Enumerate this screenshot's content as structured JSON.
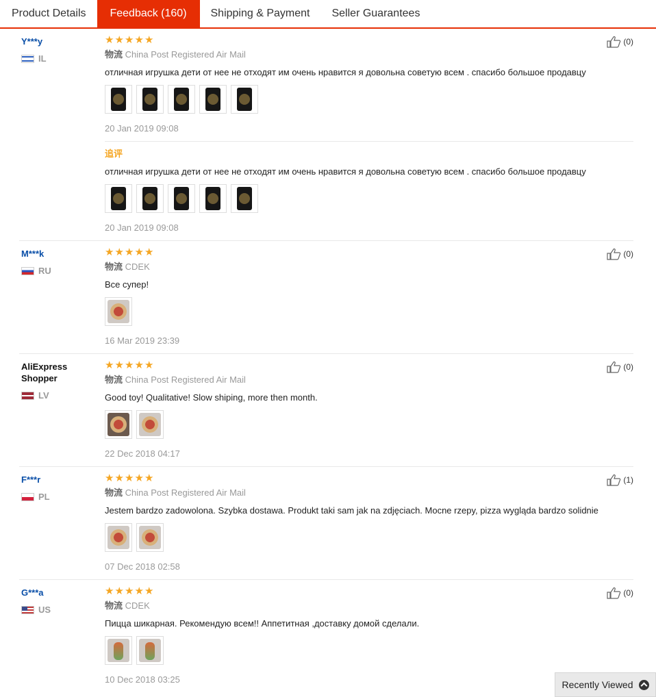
{
  "tabs": [
    {
      "label": "Product Details"
    },
    {
      "label": "Feedback (160)"
    },
    {
      "label": "Shipping & Payment"
    },
    {
      "label": "Seller Guarantees"
    }
  ],
  "colors": {
    "accent": "#e62e04",
    "star": "#f5a623",
    "user_link": "#0a4fa8"
  },
  "shipping_prefix": "物流",
  "followup_label": "追评",
  "reviews": [
    {
      "user": "Y***y",
      "country": "IL",
      "rating": 5,
      "shipping": "China Post Registered Air Mail",
      "text": "отличная игрушка дети от нее не отходят им очень нравится я довольна советую всем . спасибо большое продавцу",
      "photos": 5,
      "date": "20 Jan 2019 09:08",
      "helpful": "(0)",
      "followup": {
        "text": "отличная игрушка дети от нее не отходят им очень нравится я довольна советую всем . спасибо большое продавцу",
        "photos": 5,
        "date": "20 Jan 2019 09:08"
      }
    },
    {
      "user": "M***k",
      "country": "RU",
      "rating": 5,
      "shipping": "CDEK",
      "text": "Все супер!",
      "photos": 1,
      "date": "16 Mar 2019 23:39",
      "helpful": "(0)"
    },
    {
      "user": "AliExpress Shopper",
      "country": "LV",
      "rating": 5,
      "shipping": "China Post Registered Air Mail",
      "text": "Good toy! Qualitative! Slow shiping, more then month.",
      "photos": 2,
      "date": "22 Dec 2018 04:17",
      "helpful": "(0)"
    },
    {
      "user": "F***r",
      "country": "PL",
      "rating": 5,
      "shipping": "China Post Registered Air Mail",
      "text": "Jestem bardzo zadowolona. Szybka dostawa. Produkt taki sam jak na zdjęciach. Mocne rzepy, pizza wygląda bardzo solidnie",
      "photos": 2,
      "date": "07 Dec 2018 02:58",
      "helpful": "(1)"
    },
    {
      "user": "G***a",
      "country": "US",
      "rating": 5,
      "shipping": "CDEK",
      "text": "Пицца шикарная. Рекомендую всем!! Аппетитная ,доставку домой сделали.",
      "photos": 2,
      "date": "10 Dec 2018 03:25",
      "helpful": "(0)"
    }
  ],
  "recently_viewed": {
    "label": "Recently Viewed",
    "icon": "chevron-up-icon"
  }
}
